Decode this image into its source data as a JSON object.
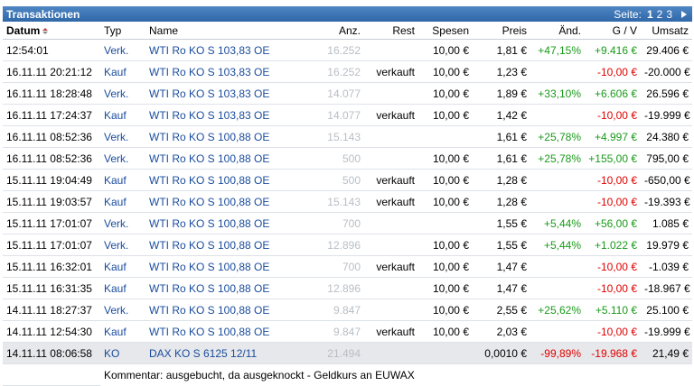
{
  "header": {
    "title": "Transaktionen",
    "pager_label": "Seite:",
    "pages": [
      "1",
      "2",
      "3"
    ]
  },
  "columns": {
    "datum": "Datum",
    "typ": "Typ",
    "name": "Name",
    "anz": "Anz.",
    "rest": "Rest",
    "spesen": "Spesen",
    "preis": "Preis",
    "aend": "Änd.",
    "gv": "G / V",
    "umsatz": "Umsatz"
  },
  "colors": {
    "gain": "#1a9a1a",
    "loss": "#e00000",
    "link": "#1a4c9c",
    "header_bar": "#3a72b3"
  },
  "rows": [
    {
      "datum": "12:54:01",
      "typ": "Verk.",
      "name": "WTI Ro KO S 103,83 OE",
      "anz": "16.252",
      "rest": "",
      "spesen": "10,00 €",
      "preis": "1,81 €",
      "aend": "+47,15%",
      "gv": "+9.416 €",
      "umsatz": "29.406 €"
    },
    {
      "datum": "16.11.11 20:21:12",
      "typ": "Kauf",
      "name": "WTI Ro KO S 103,83 OE",
      "anz": "16.252",
      "rest": "verkauft",
      "spesen": "10,00 €",
      "preis": "1,23 €",
      "aend": "",
      "gv": "-10,00 €",
      "umsatz": "-20.000 €"
    },
    {
      "datum": "16.11.11 18:28:48",
      "typ": "Verk.",
      "name": "WTI Ro KO S 103,83 OE",
      "anz": "14.077",
      "rest": "",
      "spesen": "10,00 €",
      "preis": "1,89 €",
      "aend": "+33,10%",
      "gv": "+6.606 €",
      "umsatz": "26.596 €"
    },
    {
      "datum": "16.11.11 17:24:37",
      "typ": "Kauf",
      "name": "WTI Ro KO S 103,83 OE",
      "anz": "14.077",
      "rest": "verkauft",
      "spesen": "10,00 €",
      "preis": "1,42 €",
      "aend": "",
      "gv": "-10,00 €",
      "umsatz": "-19.999 €"
    },
    {
      "datum": "16.11.11 08:52:36",
      "typ": "Verk.",
      "name": "WTI Ro KO S 100,88 OE",
      "anz": "15.143",
      "rest": "",
      "spesen": "",
      "preis": "1,61 €",
      "aend": "+25,78%",
      "gv": "+4.997 €",
      "umsatz": "24.380 €"
    },
    {
      "datum": "16.11.11 08:52:36",
      "typ": "Verk.",
      "name": "WTI Ro KO S 100,88 OE",
      "anz": "500",
      "rest": "",
      "spesen": "10,00 €",
      "preis": "1,61 €",
      "aend": "+25,78%",
      "gv": "+155,00 €",
      "umsatz": "795,00 €"
    },
    {
      "datum": "15.11.11 19:04:49",
      "typ": "Kauf",
      "name": "WTI Ro KO S 100,88 OE",
      "anz": "500",
      "rest": "verkauft",
      "spesen": "10,00 €",
      "preis": "1,28 €",
      "aend": "",
      "gv": "-10,00 €",
      "umsatz": "-650,00 €"
    },
    {
      "datum": "15.11.11 19:03:57",
      "typ": "Kauf",
      "name": "WTI Ro KO S 100,88 OE",
      "anz": "15.143",
      "rest": "verkauft",
      "spesen": "10,00 €",
      "preis": "1,28 €",
      "aend": "",
      "gv": "-10,00 €",
      "umsatz": "-19.393 €"
    },
    {
      "datum": "15.11.11 17:01:07",
      "typ": "Verk.",
      "name": "WTI Ro KO S 100,88 OE",
      "anz": "700",
      "rest": "",
      "spesen": "",
      "preis": "1,55 €",
      "aend": "+5,44%",
      "gv": "+56,00 €",
      "umsatz": "1.085 €"
    },
    {
      "datum": "15.11.11 17:01:07",
      "typ": "Verk.",
      "name": "WTI Ro KO S 100,88 OE",
      "anz": "12.896",
      "rest": "",
      "spesen": "10,00 €",
      "preis": "1,55 €",
      "aend": "+5,44%",
      "gv": "+1.022 €",
      "umsatz": "19.979 €"
    },
    {
      "datum": "15.11.11 16:32:01",
      "typ": "Kauf",
      "name": "WTI Ro KO S 100,88 OE",
      "anz": "700",
      "rest": "verkauft",
      "spesen": "10,00 €",
      "preis": "1,47 €",
      "aend": "",
      "gv": "-10,00 €",
      "umsatz": "-1.039 €"
    },
    {
      "datum": "15.11.11 16:31:35",
      "typ": "Kauf",
      "name": "WTI Ro KO S 100,88 OE",
      "anz": "12.896",
      "rest": "",
      "spesen": "10,00 €",
      "preis": "1,47 €",
      "aend": "",
      "gv": "-10,00 €",
      "umsatz": "-18.967 €"
    },
    {
      "datum": "14.11.11 18:27:37",
      "typ": "Verk.",
      "name": "WTI Ro KO S 100,88 OE",
      "anz": "9.847",
      "rest": "",
      "spesen": "10,00 €",
      "preis": "2,55 €",
      "aend": "+25,62%",
      "gv": "+5.110 €",
      "umsatz": "25.100 €"
    },
    {
      "datum": "14.11.11 12:54:30",
      "typ": "Kauf",
      "name": "WTI Ro KO S 100,88 OE",
      "anz": "9.847",
      "rest": "verkauft",
      "spesen": "10,00 €",
      "preis": "2,03 €",
      "aend": "",
      "gv": "-10,00 €",
      "umsatz": "-19.999 €"
    },
    {
      "datum": "14.11.11 08:06:58",
      "typ": "KO",
      "name": "DAX KO S 6125 12/11",
      "anz": "21.494",
      "rest": "",
      "spesen": "",
      "preis": "0,0010 €",
      "aend": "-99,89%",
      "gv": "-19.968 €",
      "umsatz": "21,49 €",
      "highlight": true
    }
  ],
  "comment": "Kommentar: ausgebucht, da ausgeknockt - Geldkurs an EUWAX"
}
